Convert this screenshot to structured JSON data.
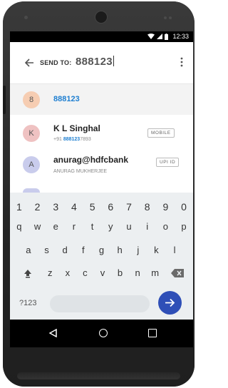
{
  "status": {
    "time": "12:33",
    "icons": [
      "wifi-icon",
      "signal-icon",
      "battery-icon"
    ]
  },
  "header": {
    "send_to_label": "SEND TO:",
    "query": "888123"
  },
  "suggestions": [
    {
      "initial": "8",
      "name": "888123",
      "avatar_color": "#f6cdb2"
    }
  ],
  "contacts": [
    {
      "initial": "K",
      "name": "K L Singhal",
      "sub_prefix": "+91 ",
      "sub_highlight": "888123",
      "sub_suffix": "7893",
      "tag": "MOBILE",
      "avatar_color": "#efc2c2"
    },
    {
      "initial": "A",
      "name": "anurag@hdfcbank",
      "sub": "ANURAG MUKHERJEE",
      "tag": "UPI ID",
      "avatar_color": "#c9ccec"
    }
  ],
  "keyboard": {
    "row_numbers": [
      "1",
      "2",
      "3",
      "4",
      "5",
      "6",
      "7",
      "8",
      "9",
      "0"
    ],
    "row_1": [
      "q",
      "w",
      "e",
      "r",
      "t",
      "y",
      "u",
      "i",
      "o",
      "p"
    ],
    "row_2": [
      "a",
      "s",
      "d",
      "f",
      "g",
      "h",
      "j",
      "k",
      "l"
    ],
    "row_3": [
      "z",
      "x",
      "c",
      "v",
      "b",
      "n",
      "m"
    ],
    "mode_key": "?123",
    "enter_icon": "arrow-right-icon",
    "shift_icon": "shift-icon",
    "backspace_icon": "backspace-icon"
  },
  "colors": {
    "accent": "#1e7fd1",
    "enter_button": "#2f4fb7",
    "keyboard_bg": "#eceff1"
  },
  "navbar": {
    "icons": [
      "nav-back-icon",
      "nav-home-icon",
      "nav-recent-icon"
    ]
  }
}
